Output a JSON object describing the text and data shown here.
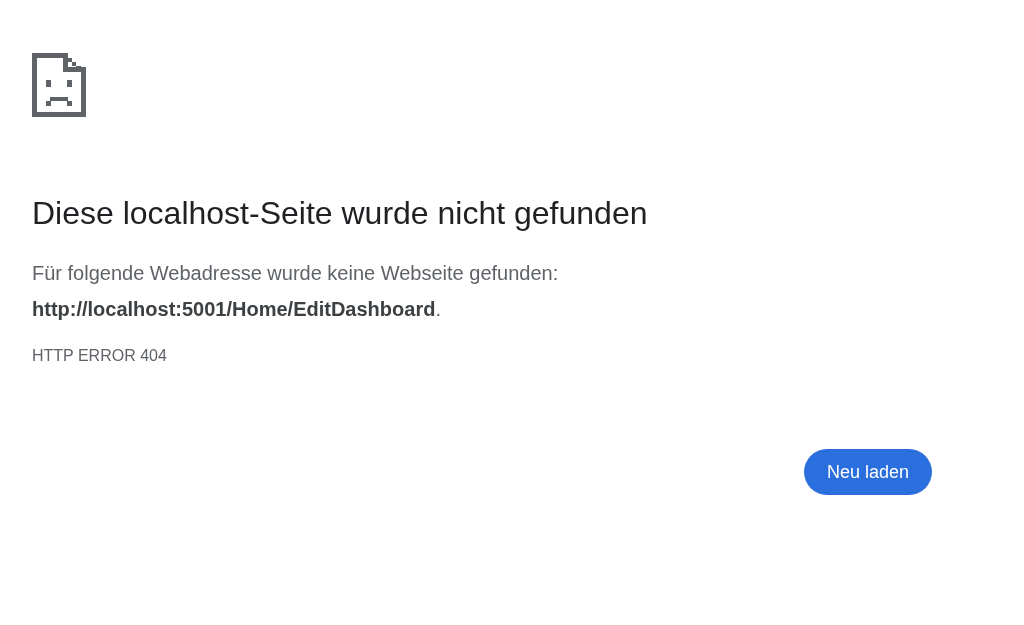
{
  "heading": "Diese localhost-Seite wurde nicht gefunden",
  "message": "Für folgende Webadresse wurde keine Webseite gefunden: **http://localhost:5001/Home/EditDashboard**.",
  "error_code": "HTTP ERROR 404",
  "buttons": [
    {
      "label": "Neu laden"
    }
  ]
}
